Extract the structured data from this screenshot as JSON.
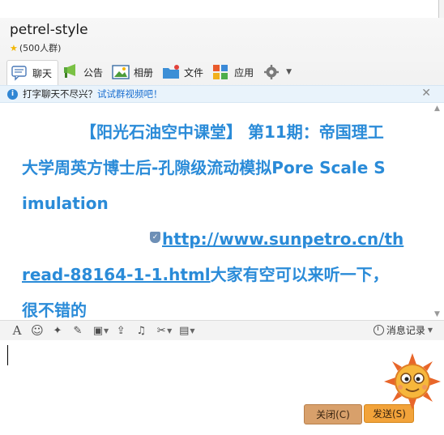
{
  "group": {
    "name": "petrel-style",
    "members": "(500人群)"
  },
  "tabs": [
    {
      "label": "聊天"
    },
    {
      "label": "公告"
    },
    {
      "label": "相册"
    },
    {
      "label": "文件"
    },
    {
      "label": "应用"
    }
  ],
  "notice": {
    "text": "打字聊天不尽兴？",
    "link": "试试群视频吧！"
  },
  "message": {
    "line1": "【阳光石油空中课堂】 第11期：帝国理工",
    "line2": "大学周英方博士后-孔隙级流动模拟Pore Scale S",
    "line3": "imulation",
    "url_part1": "http://www.sunpetro.cn/th",
    "url_part2": "read-88164-1-1.html",
    "tail1": "大家有空可以来听一下，",
    "tail2": "很不错的"
  },
  "toolbar": {
    "history_label": "消息记录"
  },
  "buttons": {
    "close": "关闭(C)",
    "send": "发送(S)"
  },
  "colors": {
    "message_text": "#2a8bd8",
    "send_button": "#f2a33a",
    "close_button": "#d8a06b"
  }
}
